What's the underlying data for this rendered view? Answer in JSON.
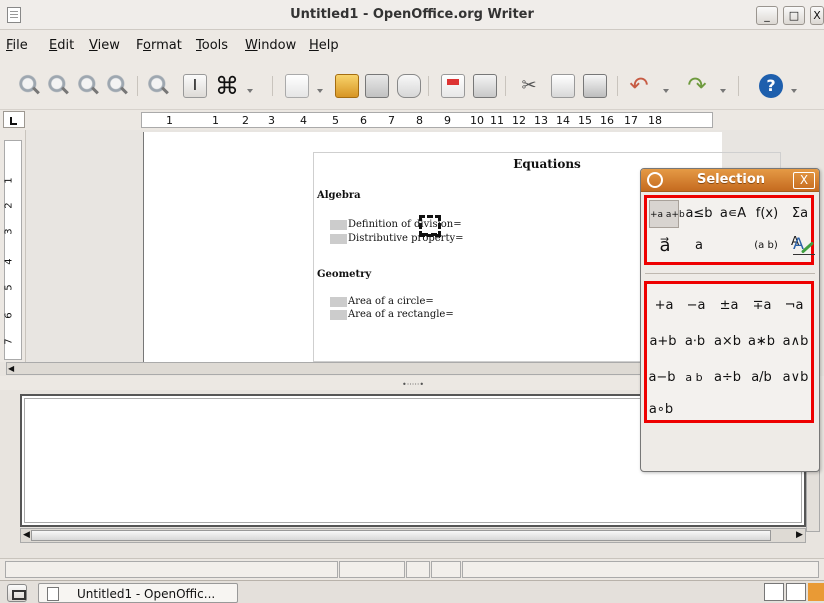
{
  "window": {
    "title": "Untitled1 - OpenOffice.org Writer",
    "controls": {
      "minimize": "_",
      "maximize": "□",
      "close": "X"
    }
  },
  "menubar": [
    {
      "label": "File",
      "accel": "F",
      "rest": "ile"
    },
    {
      "label": "Edit",
      "accel": "E",
      "rest": "dit"
    },
    {
      "label": "View",
      "accel": "V",
      "rest": "iew"
    },
    {
      "label": "Format",
      "accel": "o",
      "rest": "rmat",
      "prefix": "F"
    },
    {
      "label": "Tools",
      "accel": "T",
      "rest": "ools"
    },
    {
      "label": "Window",
      "accel": "W",
      "rest": "indow"
    },
    {
      "label": "Help",
      "accel": "H",
      "rest": "elp"
    }
  ],
  "toolbar": {
    "icons": [
      "zoom-icon",
      "zoom-out-icon",
      "zoom-100-icon",
      "zoom-page-icon",
      "zoom-width-icon",
      "text-cursor-icon",
      "command-icon",
      "new-document-icon",
      "open-folder-icon",
      "save-icon",
      "email-icon",
      "pdf-icon",
      "print-icon",
      "cut-icon",
      "copy-icon",
      "paste-icon",
      "undo-icon",
      "redo-icon",
      "help-icon"
    ],
    "command_glyph": "⌘",
    "cut_glyph": "✂",
    "undo_glyph": "↶",
    "redo_glyph": "↷",
    "help_glyph": "?"
  },
  "ruler": {
    "marks": [
      "1",
      "1",
      "2",
      "3",
      "4",
      "5",
      "6",
      "7",
      "8",
      "9",
      "10",
      "11",
      "12",
      "13",
      "14",
      "15",
      "16",
      "17",
      "18"
    ]
  },
  "vertical_ruler": [
    "1",
    "2",
    "3",
    "4",
    "5",
    "6",
    "7"
  ],
  "document": {
    "heading": "Equations",
    "algebra_title": "Algebra",
    "algebra_items": [
      "Definition of division=",
      "Distributive property="
    ],
    "geometry_title": "Geometry",
    "geometry_items": [
      "Area of a circle=",
      "Area of a rectangle="
    ]
  },
  "selection_panel": {
    "title": "Selection",
    "close": "X",
    "categories": [
      "+a a+b",
      "a≤b",
      "a∊A",
      "f(x)",
      "Σa",
      "a⃗",
      "a",
      "(a b)",
      "A"
    ],
    "symbols": [
      "+a",
      "−a",
      "±a",
      "∓a",
      "¬a",
      "a+b",
      "a⋅b",
      "a×b",
      "a∗b",
      "a∧b",
      "a−b",
      "a b",
      "a÷b",
      "a/b",
      "a∨b",
      "a∘b"
    ]
  },
  "taskbar": {
    "window_label": "Untitled1 - OpenOffic..."
  },
  "colors": {
    "selection_header": "#d9822b",
    "highlight": "#e00000",
    "window_bg": "#e8e4df"
  }
}
